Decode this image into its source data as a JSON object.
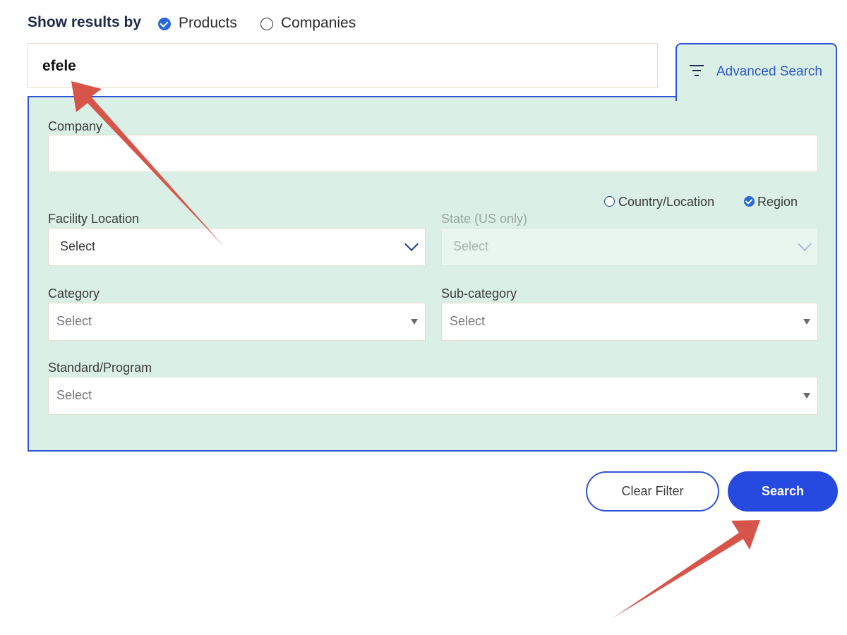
{
  "show_results_by": {
    "label": "Show results by",
    "options": [
      {
        "label": "Products",
        "selected": true
      },
      {
        "label": "Companies",
        "selected": false
      }
    ]
  },
  "search": {
    "value": "efele"
  },
  "advanced_search": {
    "label": "Advanced Search",
    "icon": "filter-icon"
  },
  "filters": {
    "company": {
      "label": "Company",
      "value": ""
    },
    "location_mode": {
      "options": [
        {
          "label": "Country/Location",
          "selected": false
        },
        {
          "label": "Region",
          "selected": true
        }
      ]
    },
    "facility_location": {
      "label": "Facility Location",
      "value": "Select"
    },
    "state": {
      "label": "State (US only)",
      "value": "Select",
      "disabled": true
    },
    "category": {
      "label": "Category",
      "value": "Select"
    },
    "sub_category": {
      "label": "Sub-category",
      "value": "Select"
    },
    "standard_program": {
      "label": "Standard/Program",
      "value": "Select"
    }
  },
  "buttons": {
    "clear_filter": "Clear Filter",
    "search": "Search"
  },
  "colors": {
    "accent": "#2f55d4",
    "panel_bg": "#daf0e6",
    "annotation_arrow": "#d65448"
  }
}
